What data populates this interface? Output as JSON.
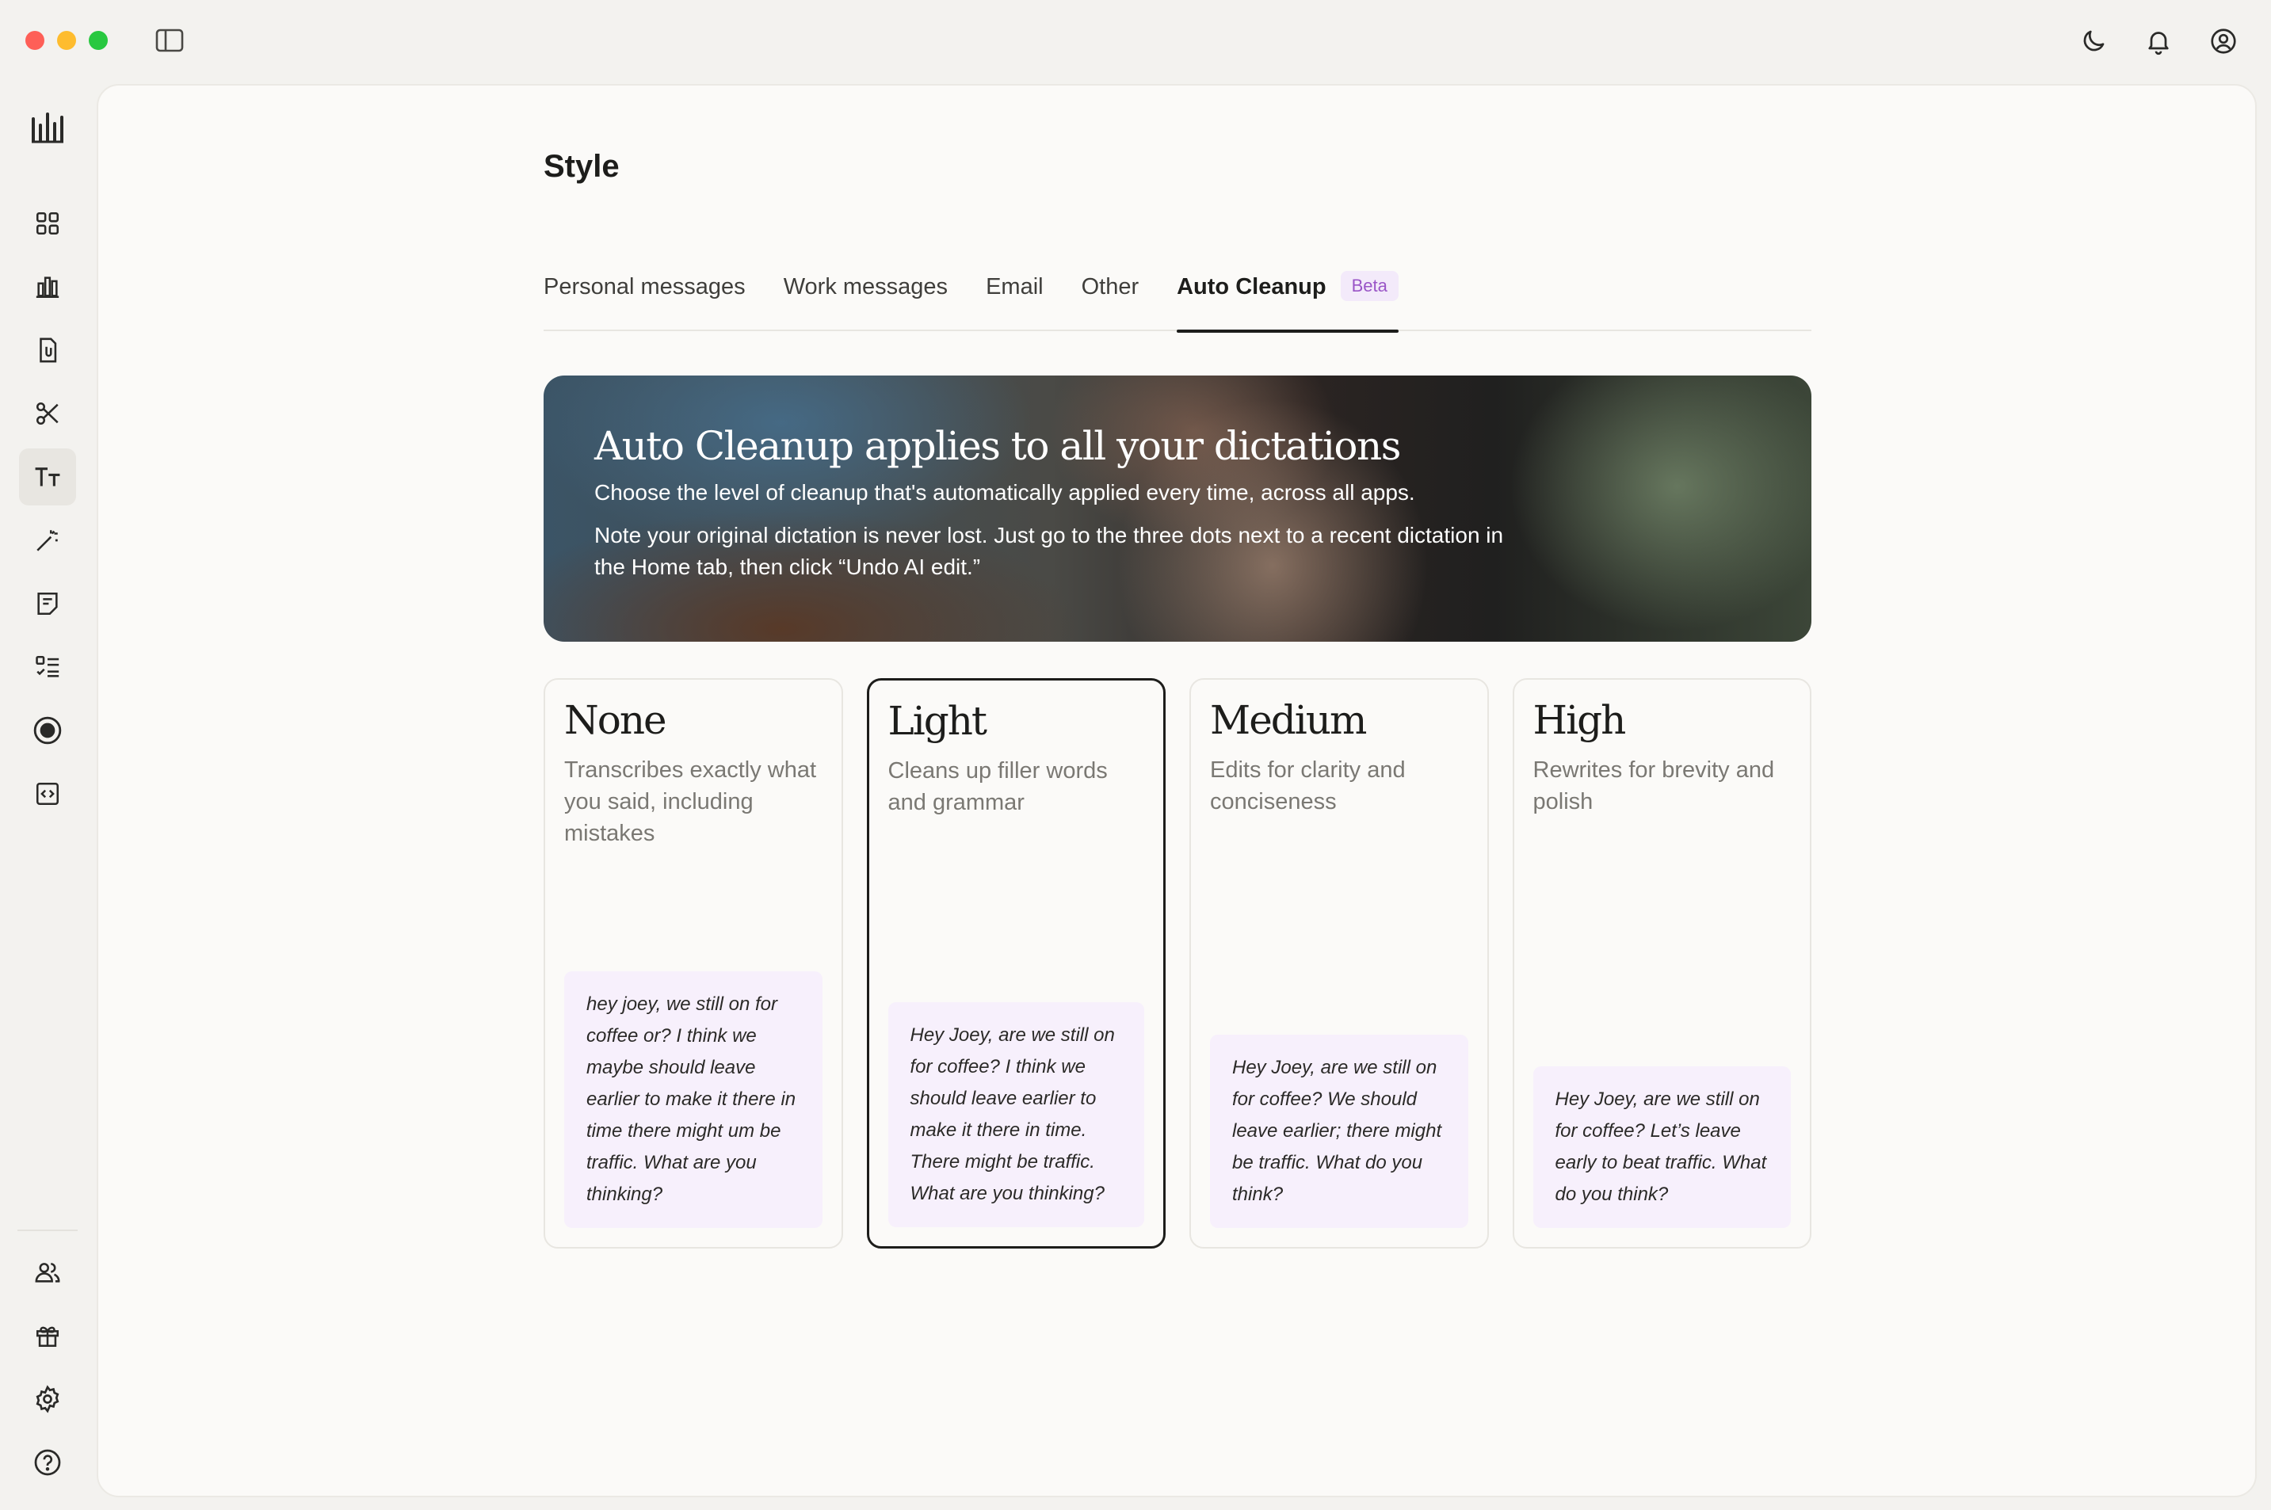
{
  "window": {
    "traffic_lights": [
      "#fe5f57",
      "#febc2e",
      "#28c840"
    ]
  },
  "topbar": {
    "icons": [
      "moon-icon",
      "bell-icon",
      "account-icon"
    ]
  },
  "rail": {
    "logo": "waveform-logo",
    "items": [
      {
        "icon": "grid-icon"
      },
      {
        "icon": "bar-chart-icon"
      },
      {
        "icon": "document-icon"
      },
      {
        "icon": "scissors-icon"
      },
      {
        "icon": "text-style-icon",
        "active": true
      },
      {
        "icon": "magic-wand-icon"
      },
      {
        "icon": "note-icon"
      },
      {
        "icon": "checklist-icon"
      },
      {
        "icon": "record-icon"
      },
      {
        "icon": "code-icon"
      }
    ],
    "bottom_items": [
      {
        "icon": "people-icon"
      },
      {
        "icon": "gift-icon"
      },
      {
        "icon": "settings-icon"
      },
      {
        "icon": "help-icon"
      }
    ]
  },
  "page": {
    "title": "Style"
  },
  "tabs": [
    {
      "label": "Personal messages"
    },
    {
      "label": "Work messages"
    },
    {
      "label": "Email"
    },
    {
      "label": "Other"
    },
    {
      "label": "Auto Cleanup",
      "badge": "Beta",
      "active": true
    }
  ],
  "banner": {
    "title": "Auto Cleanup applies to all your dictations",
    "text": "Choose the level of cleanup that's automatically applied every time, across all apps.",
    "note": "Note your original dictation is never lost. Just go to the three dots next to a recent dictation in the Home tab, then click “Undo AI edit.”"
  },
  "levels": [
    {
      "title": "None",
      "description": "Transcribes exactly what you said, including mistakes",
      "example": "hey joey, we still on for coffee or? I think we maybe should leave earlier to make it there in time there might um be traffic. What are you thinking?"
    },
    {
      "title": "Light",
      "description": "Cleans up filler words and grammar",
      "example": "Hey Joey, are we still on for coffee? I think we should leave earlier to make it there in time. There might be traffic. What are you thinking?",
      "selected": true
    },
    {
      "title": "Medium",
      "description": "Edits for clarity and conciseness",
      "example": "Hey Joey, are we still on for coffee? We should leave earlier; there might be traffic. What do you think?"
    },
    {
      "title": "High",
      "description": "Rewrites for brevity and polish",
      "example": "Hey Joey, are we still on for coffee? Let’s leave early to beat traffic. What do you think?"
    }
  ]
}
